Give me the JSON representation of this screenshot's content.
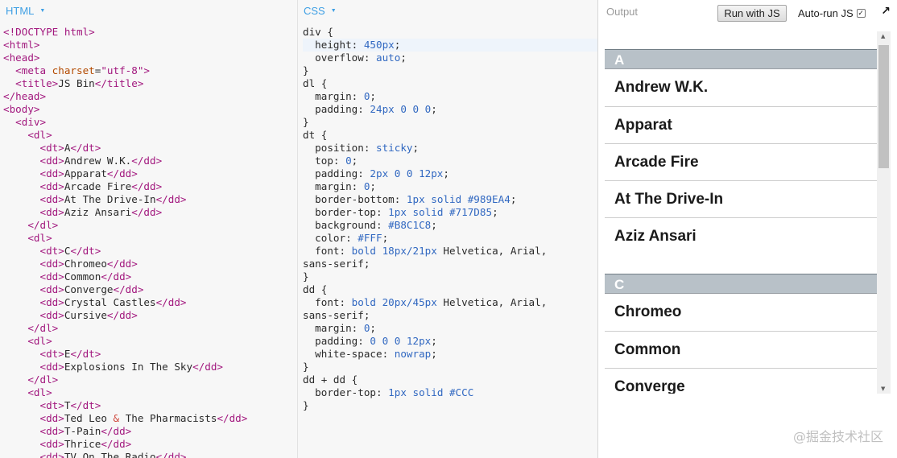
{
  "html_panel": {
    "label": "HTML",
    "lines": [
      [
        {
          "c": "t",
          "t": "<!DOCTYPE html>"
        }
      ],
      [
        {
          "c": "t",
          "t": "<html>"
        }
      ],
      [
        {
          "c": "t",
          "t": "<head>"
        }
      ],
      [
        {
          "c": "",
          "t": "  "
        },
        {
          "c": "t",
          "t": "<meta "
        },
        {
          "c": "at",
          "t": "charset"
        },
        {
          "c": "",
          "t": "="
        },
        {
          "c": "str",
          "t": "\"utf-8\""
        },
        {
          "c": "t",
          "t": ">"
        }
      ],
      [
        {
          "c": "",
          "t": "  "
        },
        {
          "c": "t",
          "t": "<title>"
        },
        {
          "c": "",
          "t": "JS Bin"
        },
        {
          "c": "t",
          "t": "</title>"
        }
      ],
      [
        {
          "c": "t",
          "t": "</head>"
        }
      ],
      [
        {
          "c": "t",
          "t": "<body>"
        }
      ],
      [
        {
          "c": "",
          "t": "  "
        },
        {
          "c": "t",
          "t": "<div>"
        }
      ],
      [
        {
          "c": "",
          "t": "    "
        },
        {
          "c": "t",
          "t": "<dl>"
        }
      ],
      [
        {
          "c": "",
          "t": "      "
        },
        {
          "c": "t",
          "t": "<dt>"
        },
        {
          "c": "",
          "t": "A"
        },
        {
          "c": "t",
          "t": "</dt>"
        }
      ],
      [
        {
          "c": "",
          "t": "      "
        },
        {
          "c": "t",
          "t": "<dd>"
        },
        {
          "c": "",
          "t": "Andrew W.K."
        },
        {
          "c": "t",
          "t": "</dd>"
        }
      ],
      [
        {
          "c": "",
          "t": "      "
        },
        {
          "c": "t",
          "t": "<dd>"
        },
        {
          "c": "",
          "t": "Apparat"
        },
        {
          "c": "t",
          "t": "</dd>"
        }
      ],
      [
        {
          "c": "",
          "t": "      "
        },
        {
          "c": "t",
          "t": "<dd>"
        },
        {
          "c": "",
          "t": "Arcade Fire"
        },
        {
          "c": "t",
          "t": "</dd>"
        }
      ],
      [
        {
          "c": "",
          "t": "      "
        },
        {
          "c": "t",
          "t": "<dd>"
        },
        {
          "c": "",
          "t": "At The Drive-In"
        },
        {
          "c": "t",
          "t": "</dd>"
        }
      ],
      [
        {
          "c": "",
          "t": "      "
        },
        {
          "c": "t",
          "t": "<dd>"
        },
        {
          "c": "",
          "t": "Aziz Ansari"
        },
        {
          "c": "t",
          "t": "</dd>"
        }
      ],
      [
        {
          "c": "",
          "t": "    "
        },
        {
          "c": "t",
          "t": "</dl>"
        }
      ],
      [
        {
          "c": "",
          "t": "    "
        },
        {
          "c": "t",
          "t": "<dl>"
        }
      ],
      [
        {
          "c": "",
          "t": "      "
        },
        {
          "c": "t",
          "t": "<dt>"
        },
        {
          "c": "",
          "t": "C"
        },
        {
          "c": "t",
          "t": "</dt>"
        }
      ],
      [
        {
          "c": "",
          "t": "      "
        },
        {
          "c": "t",
          "t": "<dd>"
        },
        {
          "c": "",
          "t": "Chromeo"
        },
        {
          "c": "t",
          "t": "</dd>"
        }
      ],
      [
        {
          "c": "",
          "t": "      "
        },
        {
          "c": "t",
          "t": "<dd>"
        },
        {
          "c": "",
          "t": "Common"
        },
        {
          "c": "t",
          "t": "</dd>"
        }
      ],
      [
        {
          "c": "",
          "t": "      "
        },
        {
          "c": "t",
          "t": "<dd>"
        },
        {
          "c": "",
          "t": "Converge"
        },
        {
          "c": "t",
          "t": "</dd>"
        }
      ],
      [
        {
          "c": "",
          "t": "      "
        },
        {
          "c": "t",
          "t": "<dd>"
        },
        {
          "c": "",
          "t": "Crystal Castles"
        },
        {
          "c": "t",
          "t": "</dd>"
        }
      ],
      [
        {
          "c": "",
          "t": "      "
        },
        {
          "c": "t",
          "t": "<dd>"
        },
        {
          "c": "",
          "t": "Cursive"
        },
        {
          "c": "t",
          "t": "</dd>"
        }
      ],
      [
        {
          "c": "",
          "t": "    "
        },
        {
          "c": "t",
          "t": "</dl>"
        }
      ],
      [
        {
          "c": "",
          "t": "    "
        },
        {
          "c": "t",
          "t": "<dl>"
        }
      ],
      [
        {
          "c": "",
          "t": "      "
        },
        {
          "c": "t",
          "t": "<dt>"
        },
        {
          "c": "",
          "t": "E"
        },
        {
          "c": "t",
          "t": "</dt>"
        }
      ],
      [
        {
          "c": "",
          "t": "      "
        },
        {
          "c": "t",
          "t": "<dd>"
        },
        {
          "c": "",
          "t": "Explosions In The Sky"
        },
        {
          "c": "t",
          "t": "</dd>"
        }
      ],
      [
        {
          "c": "",
          "t": "    "
        },
        {
          "c": "t",
          "t": "</dl>"
        }
      ],
      [
        {
          "c": "",
          "t": "    "
        },
        {
          "c": "t",
          "t": "<dl>"
        }
      ],
      [
        {
          "c": "",
          "t": "      "
        },
        {
          "c": "t",
          "t": "<dt>"
        },
        {
          "c": "",
          "t": "T"
        },
        {
          "c": "t",
          "t": "</dt>"
        }
      ],
      [
        {
          "c": "",
          "t": "      "
        },
        {
          "c": "t",
          "t": "<dd>"
        },
        {
          "c": "",
          "t": "Ted Leo "
        },
        {
          "c": "amp",
          "t": "&"
        },
        {
          "c": "",
          "t": " The Pharmacists"
        },
        {
          "c": "t",
          "t": "</dd>"
        }
      ],
      [
        {
          "c": "",
          "t": "      "
        },
        {
          "c": "t",
          "t": "<dd>"
        },
        {
          "c": "",
          "t": "T-Pain"
        },
        {
          "c": "t",
          "t": "</dd>"
        }
      ],
      [
        {
          "c": "",
          "t": "      "
        },
        {
          "c": "t",
          "t": "<dd>"
        },
        {
          "c": "",
          "t": "Thrice"
        },
        {
          "c": "t",
          "t": "</dd>"
        }
      ],
      [
        {
          "c": "",
          "t": "      "
        },
        {
          "c": "t",
          "t": "<dd>"
        },
        {
          "c": "",
          "t": "TV On The Radio"
        },
        {
          "c": "t",
          "t": "</dd>"
        }
      ]
    ]
  },
  "css_panel": {
    "label": "CSS",
    "lines": [
      [
        {
          "c": "",
          "t": "div {"
        }
      ],
      [
        {
          "c": "",
          "t": "  height: "
        },
        {
          "c": "v",
          "t": "450px"
        },
        {
          "c": "",
          "t": ";"
        }
      ],
      [
        {
          "c": "",
          "t": "  overflow: "
        },
        {
          "c": "v",
          "t": "auto"
        },
        {
          "c": "",
          "t": ";"
        }
      ],
      [
        {
          "c": "",
          "t": "}"
        }
      ],
      [
        {
          "c": "",
          "t": "dl {"
        }
      ],
      [
        {
          "c": "",
          "t": "  margin: "
        },
        {
          "c": "v",
          "t": "0"
        },
        {
          "c": "",
          "t": ";"
        }
      ],
      [
        {
          "c": "",
          "t": "  padding: "
        },
        {
          "c": "v",
          "t": "24px 0 0 0"
        },
        {
          "c": "",
          "t": ";"
        }
      ],
      [
        {
          "c": "",
          "t": "}"
        }
      ],
      [
        {
          "c": "",
          "t": "dt {"
        }
      ],
      [
        {
          "c": "",
          "t": "  position: "
        },
        {
          "c": "v",
          "t": "sticky"
        },
        {
          "c": "",
          "t": ";"
        }
      ],
      [
        {
          "c": "",
          "t": "  top: "
        },
        {
          "c": "v",
          "t": "0"
        },
        {
          "c": "",
          "t": ";"
        }
      ],
      [
        {
          "c": "",
          "t": "  padding: "
        },
        {
          "c": "v",
          "t": "2px 0 0 12px"
        },
        {
          "c": "",
          "t": ";"
        }
      ],
      [
        {
          "c": "",
          "t": "  margin: "
        },
        {
          "c": "v",
          "t": "0"
        },
        {
          "c": "",
          "t": ";"
        }
      ],
      [
        {
          "c": "",
          "t": "  border-bottom: "
        },
        {
          "c": "v",
          "t": "1px solid #989EA4"
        },
        {
          "c": "",
          "t": ";"
        }
      ],
      [
        {
          "c": "",
          "t": "  border-top: "
        },
        {
          "c": "v",
          "t": "1px solid #717D85"
        },
        {
          "c": "",
          "t": ";"
        }
      ],
      [
        {
          "c": "",
          "t": "  background: "
        },
        {
          "c": "v",
          "t": "#B8C1C8"
        },
        {
          "c": "",
          "t": ";"
        }
      ],
      [
        {
          "c": "",
          "t": "  color: "
        },
        {
          "c": "v",
          "t": "#FFF"
        },
        {
          "c": "",
          "t": ";"
        }
      ],
      [
        {
          "c": "",
          "t": "  font: "
        },
        {
          "c": "v",
          "t": "bold 18px/21px"
        },
        {
          "c": "",
          "t": " Helvetica, Arial,"
        }
      ],
      [
        {
          "c": "",
          "t": "sans-serif;"
        }
      ],
      [
        {
          "c": "",
          "t": "}"
        }
      ],
      [
        {
          "c": "",
          "t": "dd {"
        }
      ],
      [
        {
          "c": "",
          "t": "  font: "
        },
        {
          "c": "v",
          "t": "bold 20px/45px"
        },
        {
          "c": "",
          "t": " Helvetica, Arial,"
        }
      ],
      [
        {
          "c": "",
          "t": "sans-serif;"
        }
      ],
      [
        {
          "c": "",
          "t": "  margin: "
        },
        {
          "c": "v",
          "t": "0"
        },
        {
          "c": "",
          "t": ";"
        }
      ],
      [
        {
          "c": "",
          "t": "  padding: "
        },
        {
          "c": "v",
          "t": "0 0 0 12px"
        },
        {
          "c": "",
          "t": ";"
        }
      ],
      [
        {
          "c": "",
          "t": "  white-space: "
        },
        {
          "c": "v",
          "t": "nowrap"
        },
        {
          "c": "",
          "t": ";"
        }
      ],
      [
        {
          "c": "",
          "t": "}"
        }
      ],
      [
        {
          "c": "",
          "t": "dd + dd {"
        }
      ],
      [
        {
          "c": "",
          "t": "  border-top: "
        },
        {
          "c": "v",
          "t": "1px solid #CCC"
        }
      ],
      [
        {
          "c": "",
          "t": "}"
        }
      ]
    ]
  },
  "output_panel": {
    "label": "Output",
    "run_button": "Run with JS",
    "autorun_label": "Auto-run JS",
    "autorun_checked": true,
    "groups": [
      {
        "letter": "A",
        "items": [
          "Andrew W.K.",
          "Apparat",
          "Arcade Fire",
          "At The Drive-In",
          "Aziz Ansari"
        ]
      },
      {
        "letter": "C",
        "items": [
          "Chromeo",
          "Common",
          "Converge"
        ]
      }
    ]
  },
  "watermark": "@掘金技术社区",
  "colors": {
    "tab_label": "#3e9fe4",
    "dt_background": "#B8C1C8",
    "dt_border_top": "#717D85",
    "dt_border_bottom": "#989EA4",
    "dd_separator": "#CCC"
  }
}
